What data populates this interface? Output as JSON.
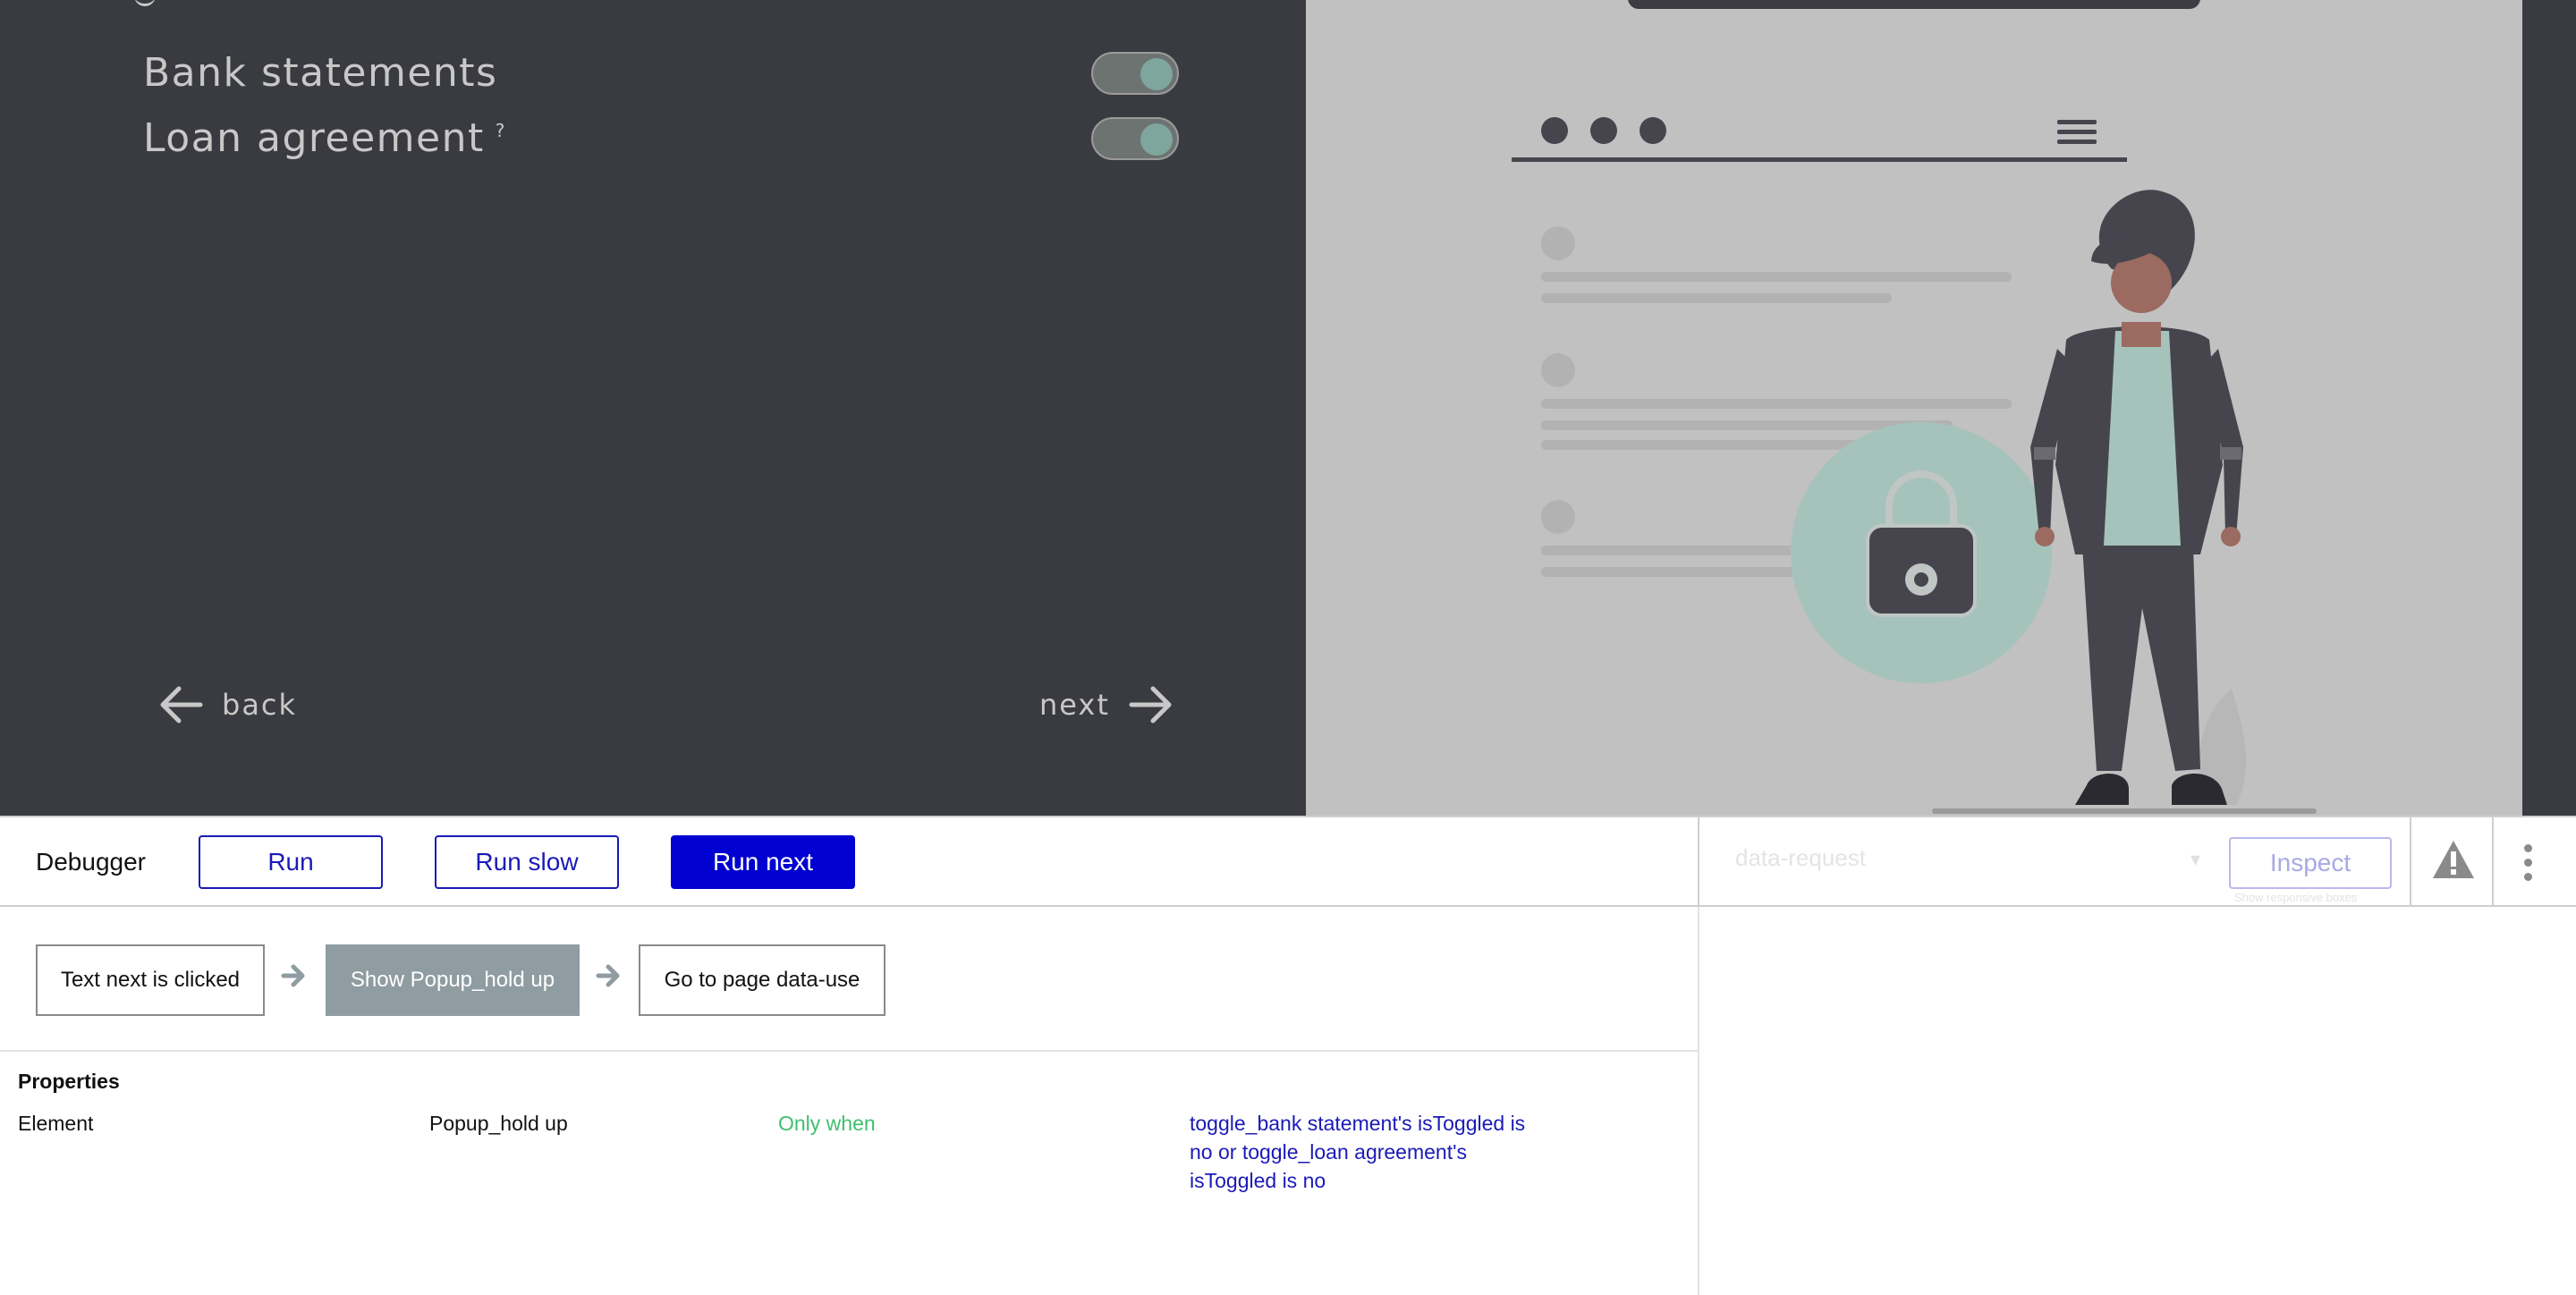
{
  "app": {
    "toggles": [
      {
        "label": "Bank statements",
        "has_help": false,
        "toggled": true
      },
      {
        "label": "Loan agreement",
        "has_help": true,
        "help_mark": "?",
        "toggled": true
      }
    ],
    "nav": {
      "back_label": "back",
      "next_label": "next"
    },
    "illustration_colors": {
      "accent": "#a5c3bb",
      "dark": "#46454e",
      "skin": "#9b6a60"
    }
  },
  "debugger": {
    "title": "Debugger",
    "run_label": "Run",
    "run_slow_label": "Run slow",
    "run_next_label": "Run next",
    "page_select_value": "data-request",
    "inspect_label": "Inspect",
    "responsive_label": "Show responsive boxes",
    "accent_color": "#0000d0"
  },
  "workflow": {
    "steps": [
      {
        "label": "Text next is clicked",
        "active": false
      },
      {
        "label": "Show Popup_hold up",
        "active": true
      },
      {
        "label": "Go to page data-use",
        "active": false
      }
    ]
  },
  "properties": {
    "title": "Properties",
    "row": {
      "name": "Element",
      "value": "Popup_hold up",
      "condition_label": "Only when",
      "condition": "toggle_bank statement's isToggled is no or toggle_loan agreement's isToggled is no"
    }
  }
}
